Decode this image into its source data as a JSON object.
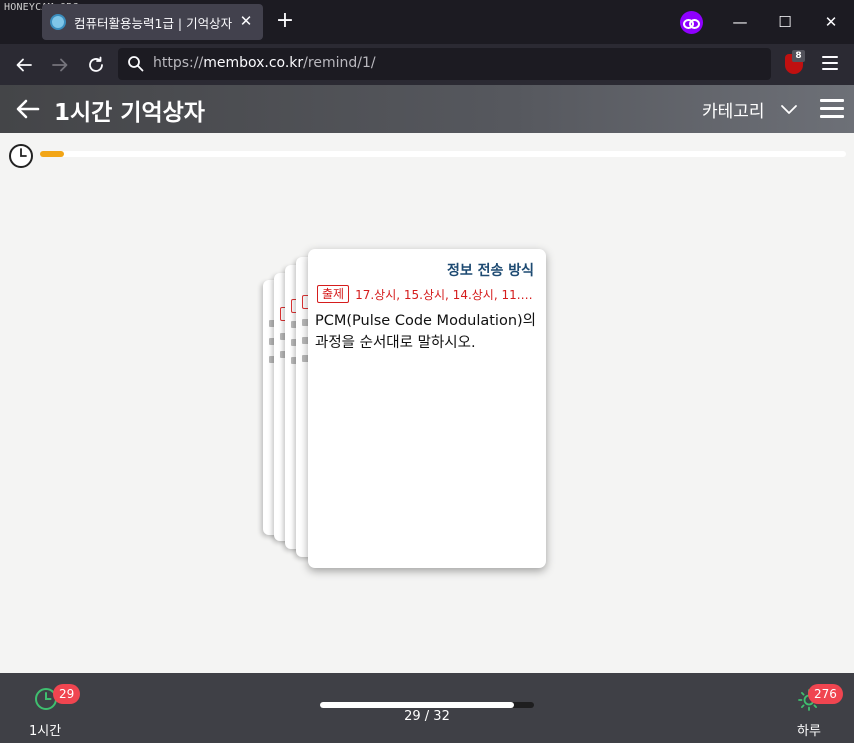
{
  "watermark": "HONEYCAM.ORG",
  "browser": {
    "tab_title": "컴퓨터활용능력1급 | 기억상자",
    "tab_close": "✕",
    "new_tab": "+",
    "url_prefix": "https://",
    "url_domain": "membox.co.kr",
    "url_path": "/remind/1/",
    "extension_badge": "8",
    "window_minimize": "—",
    "window_maximize": "☐",
    "window_close": "✕"
  },
  "header": {
    "title": "1시간 기억상자",
    "category_label": "카테고리"
  },
  "timer": {
    "progress_fraction": 0.03
  },
  "card": {
    "category": "정보 전송 방식",
    "tag": "출제",
    "sources": "17.상시, 15.상시, 14.상시, 11.9,…",
    "question": "PCM(Pulse Code Modulation)의 과정을 순서대로 말하시오."
  },
  "footer": {
    "left_label": "1시간",
    "left_badge": "29",
    "right_label": "하루",
    "right_badge": "276",
    "progress_text": "29 / 32",
    "progress_current": 29,
    "progress_total": 32
  },
  "colors": {
    "accent_orange": "#f2a516",
    "badge_red": "#f04550",
    "card_tag_red": "#d51d1d",
    "card_category_blue": "#1d4a72",
    "private_mask_purple": "#8f00ff"
  },
  "icons": [
    "globe-favicon-icon",
    "close-icon",
    "plus-icon",
    "private-mask-icon",
    "minimize-icon",
    "maximize-icon",
    "back-arrow-icon",
    "forward-arrow-icon",
    "reload-icon",
    "search-icon",
    "extension-icon",
    "menu-icon",
    "chevron-down-icon",
    "hamburger-icon",
    "timer-icon",
    "clock-icon",
    "sun-icon"
  ]
}
